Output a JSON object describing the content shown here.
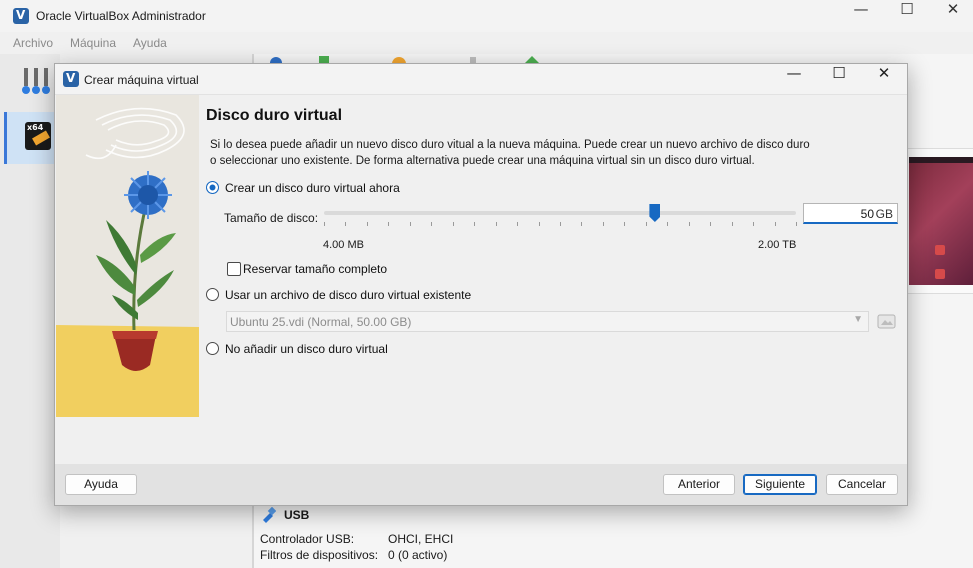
{
  "main_window": {
    "title": "Oracle VirtualBox Administrador",
    "controls": {
      "minimize": "—",
      "maximize": "☐",
      "close": "✕"
    },
    "menu": [
      "Archivo",
      "Máquina",
      "Ayuda"
    ],
    "vm_badge": "x64"
  },
  "dialog": {
    "title": "Crear máquina virtual",
    "controls": {
      "minimize": "—",
      "maximize": "☐",
      "close": "✕"
    },
    "heading": "Disco duro virtual",
    "description_line1": "Si lo desea puede añadir un nuevo disco duro vitual a la nueva máquina. Puede crear un nuevo archivo de disco duro",
    "description_line2": "o seleccionar uno existente. De forma alternativa puede crear una máquina virtual sin un disco duro virtual.",
    "options": {
      "create_new": {
        "label": "Crear un disco duro virtual ahora",
        "selected": true
      },
      "use_existing": {
        "label": "Usar un archivo de disco duro virtual existente",
        "selected": false
      },
      "no_disk": {
        "label": "No añadir un disco duro virtual",
        "selected": false
      }
    },
    "disk_size": {
      "label": "Tamaño de disco:",
      "value": "50",
      "unit": "GB",
      "min_label": "4.00 MB",
      "max_label": "2.00 TB",
      "slider_fraction": 0.7
    },
    "preallocate": {
      "label": "Reservar tamaño completo",
      "checked": false
    },
    "existing_disk": {
      "selected": "Ubuntu 25.vdi (Normal, 50.00 GB)",
      "browse_icon": "folder-icon"
    },
    "buttons": {
      "help": "Ayuda",
      "back": "Anterior",
      "next": "Siguiente",
      "cancel": "Cancelar"
    }
  },
  "details": {
    "usb": {
      "title": "USB",
      "rows": [
        {
          "key": "Controlador USB:",
          "value": "OHCI, EHCI"
        },
        {
          "key": "Filtros de dispositivos:",
          "value": "0 (0 activo)"
        }
      ]
    }
  },
  "colors": {
    "accent": "#1769c2",
    "dialog_bg": "#f0f0f0",
    "footer_bg": "#e2e2e2",
    "plant_flower": "#2f6fc6"
  }
}
